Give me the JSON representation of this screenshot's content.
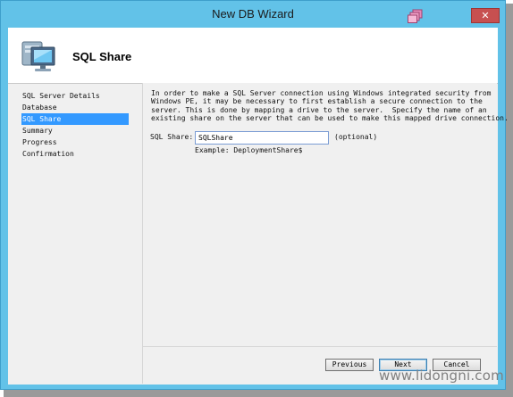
{
  "window": {
    "title": "New DB Wizard",
    "close_glyph": "✕"
  },
  "header": {
    "title": "SQL Share",
    "icon": "computer-icon"
  },
  "steps": [
    {
      "label": "SQL Server Details",
      "selected": false
    },
    {
      "label": "Database",
      "selected": false
    },
    {
      "label": "SQL Share",
      "selected": true
    },
    {
      "label": "Summary",
      "selected": false
    },
    {
      "label": "Progress",
      "selected": false
    },
    {
      "label": "Confirmation",
      "selected": false
    }
  ],
  "content": {
    "description": "In order to make a SQL Server connection using Windows integrated security from\nWindows PE, it may be necessary to first establish a secure connection to the\nserver. This is done by mapping a drive to the server.  Specify the name of an\nexisting share on the server that can be used to make this mapped drive connection.",
    "share_label": "SQL Share:",
    "share_value": "SQLShare",
    "optional": "(optional)",
    "example": "Example:  DeploymentShare$"
  },
  "buttons": {
    "previous": "Previous",
    "next": "Next",
    "cancel": "Cancel"
  },
  "watermark": "www.lidongni.com",
  "colors": {
    "titlebar": "#62c2e8",
    "selection": "#3399ff",
    "close": "#c75050"
  }
}
